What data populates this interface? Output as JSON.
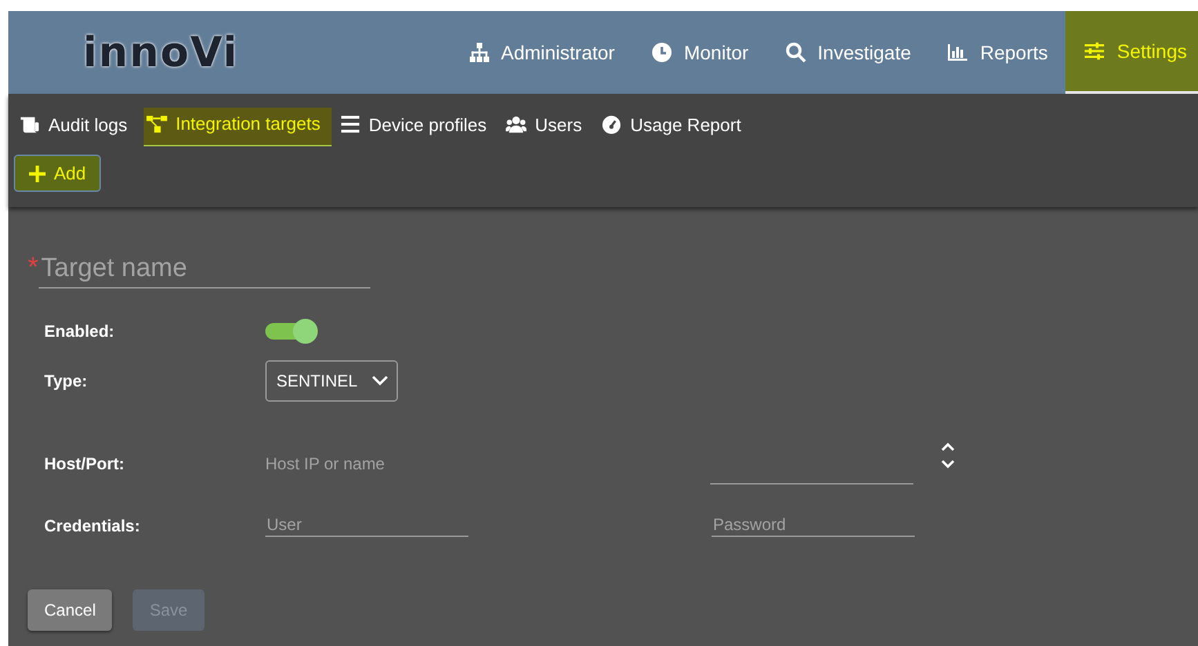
{
  "logo": "innoVi",
  "nav": [
    {
      "label": "Administrator",
      "selected": false
    },
    {
      "label": "Monitor",
      "selected": false
    },
    {
      "label": "Investigate",
      "selected": false
    },
    {
      "label": "Reports",
      "selected": false
    },
    {
      "label": "Settings",
      "selected": true
    }
  ],
  "subnav": [
    {
      "label": "Audit logs",
      "selected": false
    },
    {
      "label": "Integration targets",
      "selected": true
    },
    {
      "label": "Device profiles",
      "selected": false
    },
    {
      "label": "Users",
      "selected": false
    },
    {
      "label": "Usage Report",
      "selected": false
    }
  ],
  "add_button": {
    "label": "Add"
  },
  "form": {
    "target_name": {
      "placeholder": "Target name",
      "required_mark": "*"
    },
    "enabled": {
      "label": "Enabled:",
      "on": true
    },
    "type": {
      "label": "Type:",
      "value": "SENTINEL"
    },
    "host_port": {
      "label": "Host/Port:",
      "host_placeholder": "Host IP or name"
    },
    "credentials": {
      "label": "Credentials:",
      "user_placeholder": "User",
      "password_placeholder": "Password"
    }
  },
  "buttons": [
    {
      "label": "Cancel",
      "disabled": false
    },
    {
      "label": "Save",
      "disabled": true
    }
  ]
}
